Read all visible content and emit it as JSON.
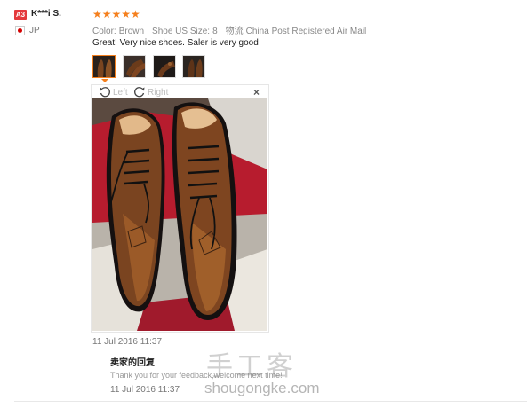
{
  "reviewer": {
    "badge": "A3",
    "name": "K***i S.",
    "country": "JP"
  },
  "review": {
    "stars": "★★★★★",
    "color_label": "Color:",
    "color_value": "Brown",
    "size_label": "Shoe US Size:",
    "size_value": "8",
    "shipping_label": "物流",
    "shipping_value": "China Post Registered Air Mail",
    "text": "Great! Very nice shoes. Saler is very good",
    "date": "11 Jul 2016 11:37"
  },
  "viewer": {
    "left_label": "Left",
    "right_label": "Right",
    "close_label": "×"
  },
  "seller": {
    "title": "卖家的回复",
    "text": "Thank you for your feedback,welcome next time!",
    "date": "11 Jul 2016 11:37"
  },
  "watermark": {
    "cn": "手工客",
    "en": "shougongke.com"
  },
  "colors": {
    "accent": "#f5801e",
    "badge": "#e4393c"
  }
}
